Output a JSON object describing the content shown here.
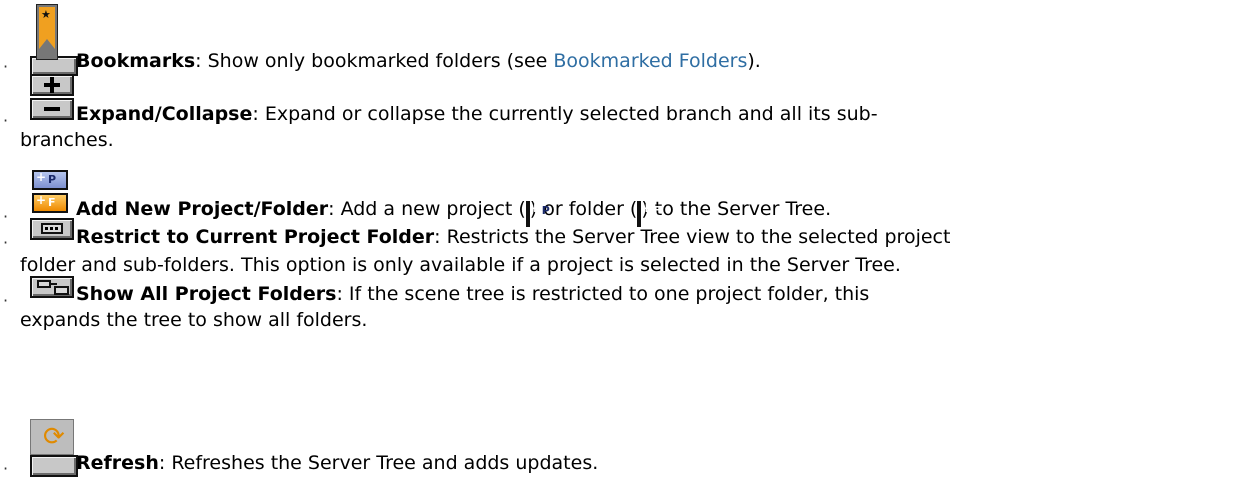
{
  "bookmarks": {
    "term": "Bookmarks",
    "text_before": ": Show only bookmarked folders (see ",
    "link": "Bookmarked Folders",
    "text_after": ")."
  },
  "expand": {
    "term": "Expand/Collapse",
    "text_line1": ": Expand or collapse the currently selected branch and all its sub-",
    "text_line2": "branches."
  },
  "add_new": {
    "term": "Add New Project/Folder",
    "text1": ": Add a new project (",
    "text2": ") or folder (",
    "text3": ") to the Server Tree.",
    "project_letter": "P",
    "folder_letter": "F"
  },
  "restrict": {
    "term": "Restrict to Current Project Folder",
    "text_line1": ": Restricts the Server Tree view to the selected project",
    "text_line2": "folder and sub-folders. This option is only available if a project is selected in the Server Tree."
  },
  "show_all": {
    "term": "Show All Project Folders",
    "text_line1": ": If the scene tree is restricted to one project folder, this",
    "text_line2": "expands the tree to show all folders."
  },
  "refresh": {
    "term": "Refresh",
    "text": ": Refreshes the Server Tree and adds updates."
  },
  "bullet": "·",
  "colors": {
    "link": "#2f6ea3",
    "project_tile": "#9aaae0",
    "folder_tile": "#f6a21e"
  },
  "icons": [
    "bookmark-icon",
    "expand-icon",
    "collapse-icon",
    "add-project-icon",
    "add-folder-icon",
    "restrict-folder-icon",
    "show-all-folders-icon",
    "refresh-icon"
  ]
}
